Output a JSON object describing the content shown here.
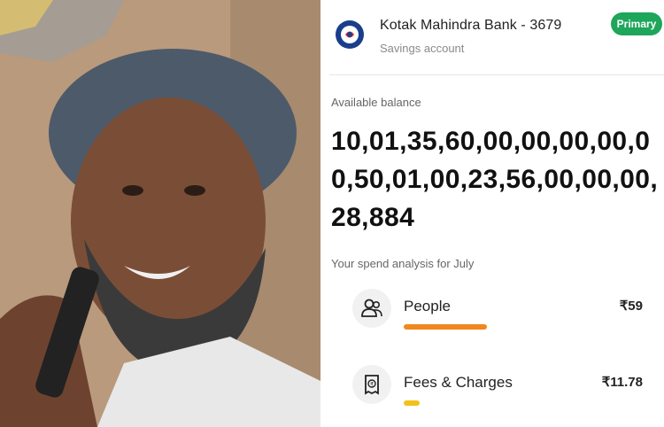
{
  "bank": {
    "name": "Kotak Mahindra Bank - 3679",
    "account_type": "Savings account",
    "badge": "Primary"
  },
  "balance": {
    "label": "Available balance",
    "value": "10,01,35,60,00,00,00,00,00,50,01,00,23,56,00,00,00,28,884"
  },
  "spend": {
    "label": "Your spend analysis for July",
    "items": [
      {
        "name": "People",
        "amount": "₹59",
        "icon": "people-icon",
        "bar_color": "#f0881e",
        "bar_fill": 0.42
      },
      {
        "name": "Fees & Charges",
        "amount": "₹11.78",
        "icon": "receipt-icon",
        "bar_color": "#f2c21a",
        "bar_fill": 0.08
      }
    ]
  },
  "colors": {
    "primary_badge": "#1ea65a",
    "logo_red": "#e0262b",
    "logo_blue": "#1a3e8c"
  }
}
